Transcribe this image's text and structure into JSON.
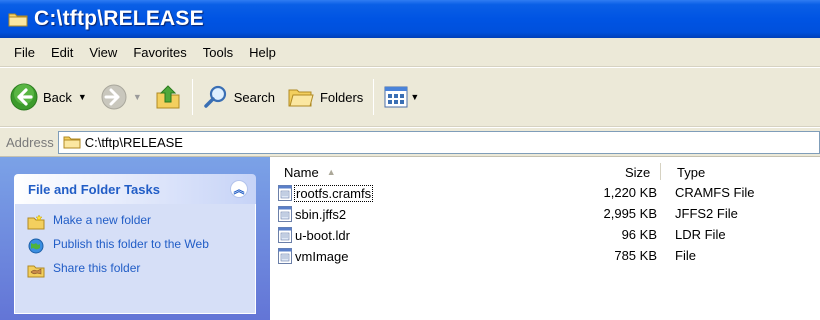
{
  "window": {
    "title": "C:\\tftp\\RELEASE"
  },
  "menu": [
    "File",
    "Edit",
    "View",
    "Favorites",
    "Tools",
    "Help"
  ],
  "toolbar": {
    "back_label": "Back",
    "search_label": "Search",
    "folders_label": "Folders"
  },
  "address": {
    "label": "Address",
    "value": "C:\\tftp\\RELEASE"
  },
  "tasks": {
    "header": "File and Folder Tasks",
    "items": [
      {
        "label": "Make a new folder",
        "icon": "new-folder-icon"
      },
      {
        "label": "Publish this folder to the Web",
        "icon": "publish-web-icon"
      },
      {
        "label": "Share this folder",
        "icon": "share-folder-icon"
      }
    ]
  },
  "columns": {
    "name": "Name",
    "size": "Size",
    "type": "Type"
  },
  "files": [
    {
      "name": "rootfs.cramfs",
      "size": "1,220 KB",
      "type": "CRAMFS File",
      "selected": true
    },
    {
      "name": "sbin.jffs2",
      "size": "2,995 KB",
      "type": "JFFS2 File",
      "selected": false
    },
    {
      "name": "u-boot.ldr",
      "size": "96 KB",
      "type": "LDR File",
      "selected": false
    },
    {
      "name": "vmImage",
      "size": "785 KB",
      "type": "File",
      "selected": false
    }
  ],
  "colors": {
    "title_blue": "#0054e3",
    "task_pane_blue": "#6375d6",
    "link_blue": "#215dc6"
  }
}
